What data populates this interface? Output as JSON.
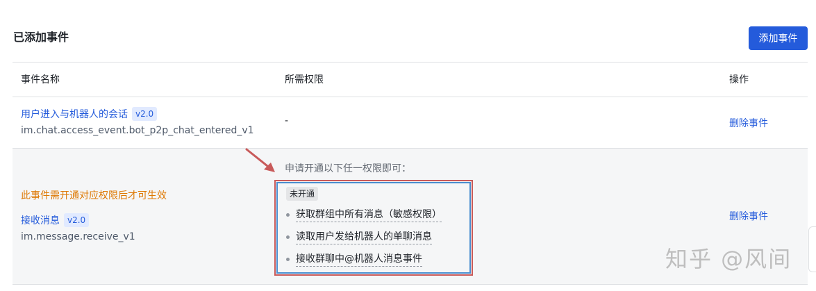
{
  "section": {
    "title": "已添加事件",
    "add_button": "添加事件"
  },
  "table": {
    "headers": {
      "name": "事件名称",
      "permission": "所需权限",
      "action": "操作"
    },
    "rows": [
      {
        "name": "用户进入与机器人的会话",
        "version": "v2.0",
        "event_id": "im.chat.access_event.bot_p2p_chat_entered_v1",
        "permission": "-",
        "action": "删除事件"
      },
      {
        "warning": "此事件需开通对应权限后才可生效",
        "name": "接收消息",
        "version": "v2.0",
        "event_id": "im.message.receive_v1",
        "permission_intro": "申请开通以下任一权限即可：",
        "permission_status": "未开通",
        "permissions": [
          "获取群组中所有消息（敏感权限）",
          "读取用户发给机器人的单聊消息",
          "接收群聊中@机器人消息事件"
        ],
        "action": "删除事件"
      }
    ]
  },
  "watermark": "知乎 @风间",
  "colors": {
    "primary": "#245bdb",
    "warning": "#de7802",
    "annotation_red": "#c85a5a",
    "annotation_blue": "#4a8fd0"
  }
}
